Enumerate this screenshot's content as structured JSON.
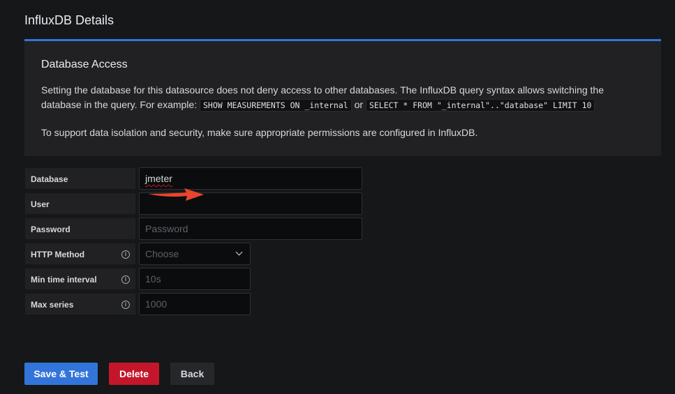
{
  "section_title": "InfluxDB Details",
  "info": {
    "title": "Database Access",
    "p1_text1": "Setting the database for this datasource does not deny access to other databases. The InfluxDB query syntax allows switching the database in the query. For example:",
    "code1": "SHOW MEASUREMENTS ON _internal",
    "or_text": "or",
    "code2": "SELECT * FROM \"_internal\"..\"database\" LIMIT 10",
    "p2": "To support data isolation and security, make sure appropriate permissions are configured in InfluxDB."
  },
  "fields": {
    "database": {
      "label": "Database",
      "value": "jmeter"
    },
    "user": {
      "label": "User",
      "value": ""
    },
    "password": {
      "label": "Password",
      "placeholder": "Password"
    },
    "http_method": {
      "label": "HTTP Method",
      "placeholder": "Choose"
    },
    "min_time_interval": {
      "label": "Min time interval",
      "placeholder": "10s"
    },
    "max_series": {
      "label": "Max series",
      "placeholder": "1000"
    }
  },
  "buttons": {
    "save": "Save & Test",
    "delete": "Delete",
    "back": "Back"
  },
  "icons": {
    "info": "info-circle-icon",
    "chevron": "chevron-down-icon",
    "arrow": "arrow-right-icon"
  },
  "colors": {
    "accent": "#3274d9",
    "danger": "#c4162a",
    "arrow": "#e8452c"
  }
}
